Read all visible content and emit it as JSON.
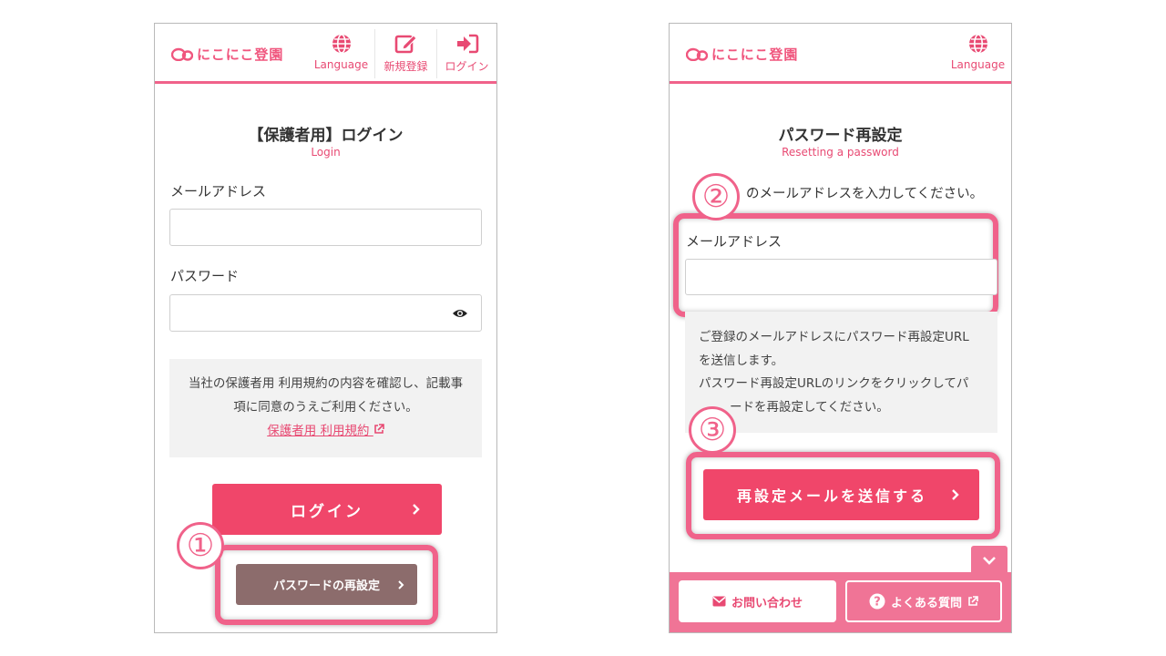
{
  "header": {
    "logo_text": "にこにこ登園",
    "language_label": "Language",
    "signup_label": "新規登録",
    "login_label": "ログイン"
  },
  "login_screen": {
    "title": "【保護者用】ログイン",
    "subtitle": "Login",
    "email_label": "メールアドレス",
    "email_value": "",
    "password_label": "パスワード",
    "password_value": "",
    "notice_line1": "当社の保護者用 利用規約の内容を確認し、記載事",
    "notice_line2": "項に同意のうえご利用ください。",
    "terms_link": "保護者用 利用規約",
    "login_button": "ログイン",
    "reset_button": "パスワードの再設定",
    "step_number": "①"
  },
  "reset_screen": {
    "title": "パスワード再設定",
    "subtitle": "Resetting a password",
    "instruction_prefix": "..",
    "instruction": "のメールアドレスを入力してください。",
    "email_label": "メールアドレス",
    "email_value": "",
    "info_line1": "ご登録のメールアドレスにパスワード再設定URL",
    "info_line2": "を送信します。",
    "info_line3": "パスワード再設定URLのリンクをクリックしてパ",
    "info_line4": "ードを再設定してください。",
    "send_button": "再設定メールを送信する",
    "step2": "②",
    "step3": "③"
  },
  "footer": {
    "contact_label": "お問い合わせ",
    "faq_label": "よくある質問"
  },
  "colors": {
    "brand_pink": "#f0628a",
    "button_pink": "#f0466a",
    "button_brown": "#8c6c6c"
  },
  "icons": [
    "globe-icon",
    "edit-icon",
    "sign-in-icon",
    "eye-icon",
    "external-link-icon",
    "chevron-right-icon",
    "chevron-down-icon",
    "envelope-icon",
    "question-circle-icon"
  ]
}
